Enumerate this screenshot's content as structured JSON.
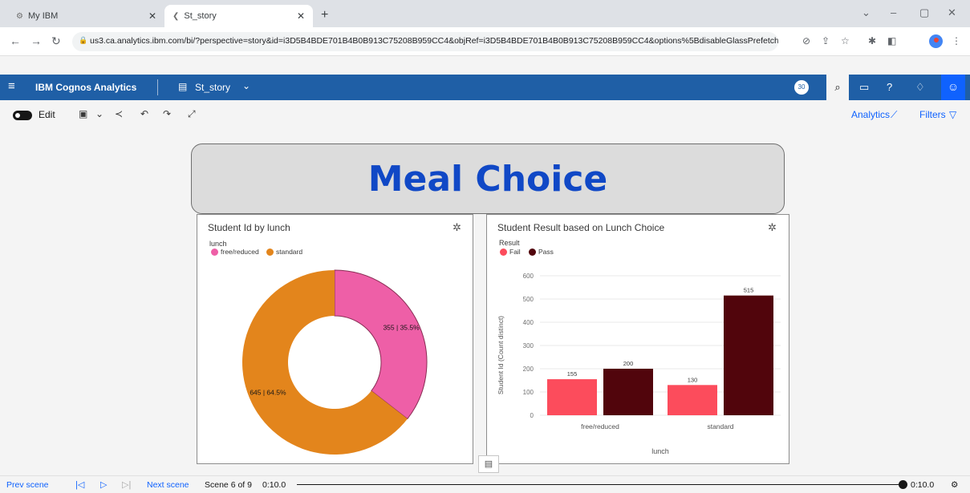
{
  "browser": {
    "tabs": [
      {
        "label": "My IBM",
        "active": false
      },
      {
        "label": "St_story",
        "active": true
      }
    ],
    "url": "us3.ca.analytics.ibm.com/bi/?perspective=story&id=i3D5B4BDE701B4B0B913C75208B959CC4&objRef=i3D5B4BDE701B4B0B913C75208B959CC4&options%5BdisableGlassPrefetch%5D=..."
  },
  "app": {
    "brand_prefix": "IBM",
    "brand_name": "Cognos Analytics",
    "story_name": "St_story",
    "badge": "30"
  },
  "toolbar": {
    "edit_label": "Edit",
    "analytics_label": "Analytics",
    "filters_label": "Filters"
  },
  "scene": {
    "title": "Meal Choice"
  },
  "donut": {
    "title": "Student Id by lunch",
    "legend_title": "lunch",
    "legend": [
      {
        "name": "free/reduced",
        "color": "#ee5fa7"
      },
      {
        "name": "standard",
        "color": "#e3851c"
      }
    ]
  },
  "bar": {
    "title": "Student Result based on Lunch Choice",
    "legend_title": "Result",
    "legend": [
      {
        "name": "Fail",
        "color": "#fc4c5c"
      },
      {
        "name": "Pass",
        "color": "#51050c"
      }
    ]
  },
  "chart_data": [
    {
      "type": "pie",
      "title": "Student Id by lunch",
      "categories": [
        "free/reduced",
        "standard"
      ],
      "values": [
        355,
        645
      ],
      "labels": [
        "355 | 35.5%",
        "645 | 64.5%"
      ],
      "colors": [
        "#ee5fa7",
        "#e3851c"
      ]
    },
    {
      "type": "bar",
      "title": "Student Result based on Lunch Choice",
      "categories": [
        "free/reduced",
        "standard"
      ],
      "series": [
        {
          "name": "Fail",
          "values": [
            155,
            130
          ],
          "color": "#fc4c5c"
        },
        {
          "name": "Pass",
          "values": [
            200,
            515
          ],
          "color": "#51050c"
        }
      ],
      "xlabel": "lunch",
      "ylabel": "Student Id (Count distinct)",
      "ylim": [
        0,
        600
      ],
      "yticks": [
        "0",
        "100",
        "200",
        "300",
        "400",
        "500",
        "600"
      ]
    }
  ],
  "footer": {
    "prev_label": "Prev scene",
    "next_label": "Next scene",
    "scene_counter": "Scene 6 of 9",
    "time_start": "0:10.0",
    "time_end": "0:10.0"
  }
}
